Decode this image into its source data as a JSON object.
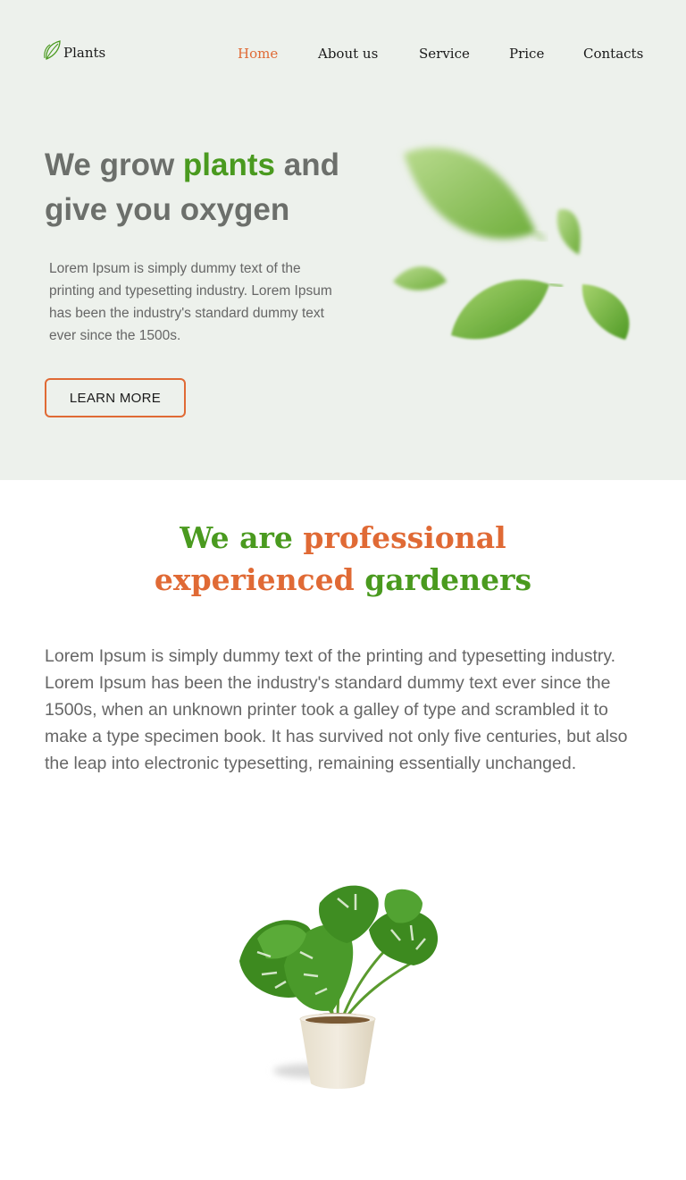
{
  "brand": {
    "name": "Plants",
    "icon": "leaf-outline-icon"
  },
  "nav": [
    {
      "label": "Home",
      "active": true
    },
    {
      "label": "About us",
      "active": false
    },
    {
      "label": "Service",
      "active": false
    },
    {
      "label": "Price",
      "active": false
    },
    {
      "label": "Contacts",
      "active": false
    }
  ],
  "hero": {
    "title_before": "We grow ",
    "title_accent": "plants",
    "title_after": " and give you oxygen",
    "description": "Lorem Ipsum is simply dummy text of the printing and typesetting industry. Lorem Ipsum has been the industry's standard dummy text ever since the 1500s.",
    "button_label": "LEARN MORE",
    "image": "falling-green-leaves"
  },
  "about": {
    "title_part1": "We are ",
    "title_part2": "professional",
    "title_part3": "experienced",
    "title_part4": " gardeners",
    "description": "Lorem Ipsum is simply dummy text of the printing and typesetting industry. Lorem Ipsum has been the industry's standard dummy text ever since the 1500s, when an unknown printer took a galley of type and scrambled it to make a type specimen book. It has survived not only five centuries, but also the leap into electronic typesetting, remaining essentially unchanged.",
    "image": "monstera-plant-in-pot"
  },
  "colors": {
    "hero_background": "#edf1ec",
    "accent_green": "#4a9a1f",
    "accent_orange": "#e06a35",
    "heading_gray": "#6c6f6b",
    "body_text": "#666666"
  }
}
